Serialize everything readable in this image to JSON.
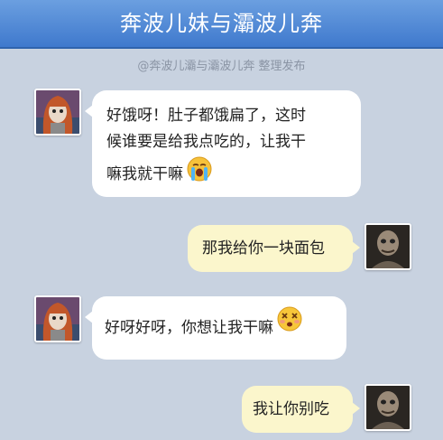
{
  "header": {
    "title": "奔波儿妹与灞波儿奔"
  },
  "subtitle": "@奔波儿灞与灞波儿奔 整理发布",
  "messages": [
    {
      "side": "left",
      "text_lines": [
        "好饿呀！肚子都饿扁了，这时",
        "候谁要是给我点吃的，让我干",
        "嘛我就干嘛"
      ],
      "emoji": "crying-face-icon"
    },
    {
      "side": "right",
      "text": "那我给你一块面包"
    },
    {
      "side": "left",
      "text": "好呀好呀，你想让我干嘛",
      "emoji": "dizzy-face-icon"
    },
    {
      "side": "right",
      "text": "我让你别吃"
    }
  ],
  "colors": {
    "header": "#4a86d6",
    "background": "#c8d2e0",
    "left_bubble": "#ffffff",
    "right_bubble": "#fbf6cc"
  }
}
